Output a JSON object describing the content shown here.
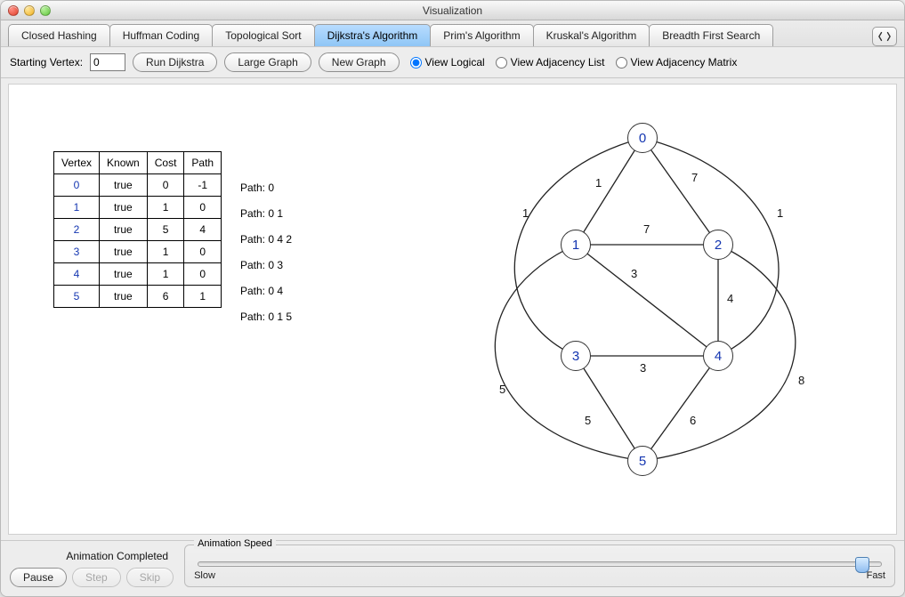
{
  "window": {
    "title": "Visualization"
  },
  "tabs": {
    "items": [
      {
        "label": "Closed Hashing"
      },
      {
        "label": "Huffman Coding"
      },
      {
        "label": "Topological Sort"
      },
      {
        "label": "Dijkstra's Algorithm",
        "active": true
      },
      {
        "label": "Prim's Algorithm"
      },
      {
        "label": "Kruskal's Algorithm"
      },
      {
        "label": "Breadth First Search"
      }
    ]
  },
  "toolbar": {
    "start_label": "Starting Vertex:",
    "start_value": "0",
    "run_label": "Run Dijkstra",
    "large_label": "Large Graph",
    "new_label": "New Graph",
    "view_options": {
      "logical": "View Logical",
      "adjlist": "View Adjacency List",
      "adjmatrix": "View Adjacency Matrix",
      "selected": "logical"
    }
  },
  "table": {
    "headers": [
      "Vertex",
      "Known",
      "Cost",
      "Path"
    ],
    "rows": [
      {
        "vertex": "0",
        "known": "true",
        "cost": "0",
        "path": "-1",
        "path_text": "Path: 0"
      },
      {
        "vertex": "1",
        "known": "true",
        "cost": "1",
        "path": "0",
        "path_text": "Path: 0 1"
      },
      {
        "vertex": "2",
        "known": "true",
        "cost": "5",
        "path": "4",
        "path_text": "Path: 0 4 2"
      },
      {
        "vertex": "3",
        "known": "true",
        "cost": "1",
        "path": "0",
        "path_text": "Path: 0 3"
      },
      {
        "vertex": "4",
        "known": "true",
        "cost": "1",
        "path": "0",
        "path_text": "Path: 0 4"
      },
      {
        "vertex": "5",
        "known": "true",
        "cost": "6",
        "path": "1",
        "path_text": "Path: 0 1 5"
      }
    ]
  },
  "graph": {
    "nodes": {
      "0": "0",
      "1": "1",
      "2": "2",
      "3": "3",
      "4": "4",
      "5": "5"
    },
    "edge_weights": {
      "e01": "1",
      "e02": "7",
      "e12": "7",
      "e14": "3",
      "e24": "4",
      "e34": "3",
      "e35": "5",
      "e45": "6",
      "e03": "1",
      "e04": "1",
      "e25": "8",
      "e15": "5"
    }
  },
  "footer": {
    "status": "Animation Completed",
    "pause": "Pause",
    "step": "Step",
    "skip": "Skip",
    "speed_legend": "Animation Speed",
    "slow": "Slow",
    "fast": "Fast",
    "slider_pos_pct": 98
  }
}
